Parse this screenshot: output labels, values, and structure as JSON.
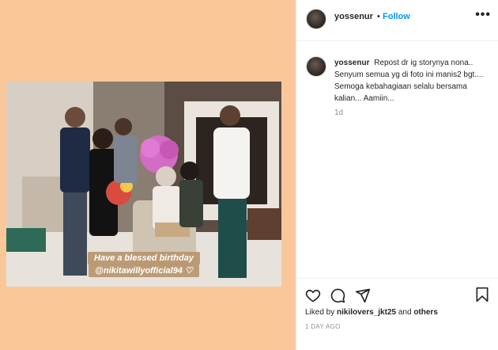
{
  "header": {
    "username": "yossenur",
    "dot": "•",
    "follow_label": "Follow",
    "more_label": "•••"
  },
  "photo": {
    "caption_line1": "Have a blessed birthday",
    "caption_line2": "@nikitawillyofficial94 ♡"
  },
  "comment": {
    "username": "yossenur",
    "text": "Repost dr ig storynya nona.. Senyum semua yg di foto ini manis2 bgt.... Semoga kebahagiaan selalu bersama kalian... Aamiin...",
    "time": "1d"
  },
  "likes": {
    "prefix": "Liked by",
    "user": "nikilovers_jkt25",
    "and": "and",
    "others": "others"
  },
  "post_date": "1 DAY AGO",
  "icons": [
    "heart-icon",
    "comment-icon",
    "share-icon",
    "bookmark-icon",
    "more-icon"
  ],
  "colors": {
    "background_left": "#f9c79a",
    "follow_blue": "#0095f6",
    "muted": "#8e8e8e"
  }
}
